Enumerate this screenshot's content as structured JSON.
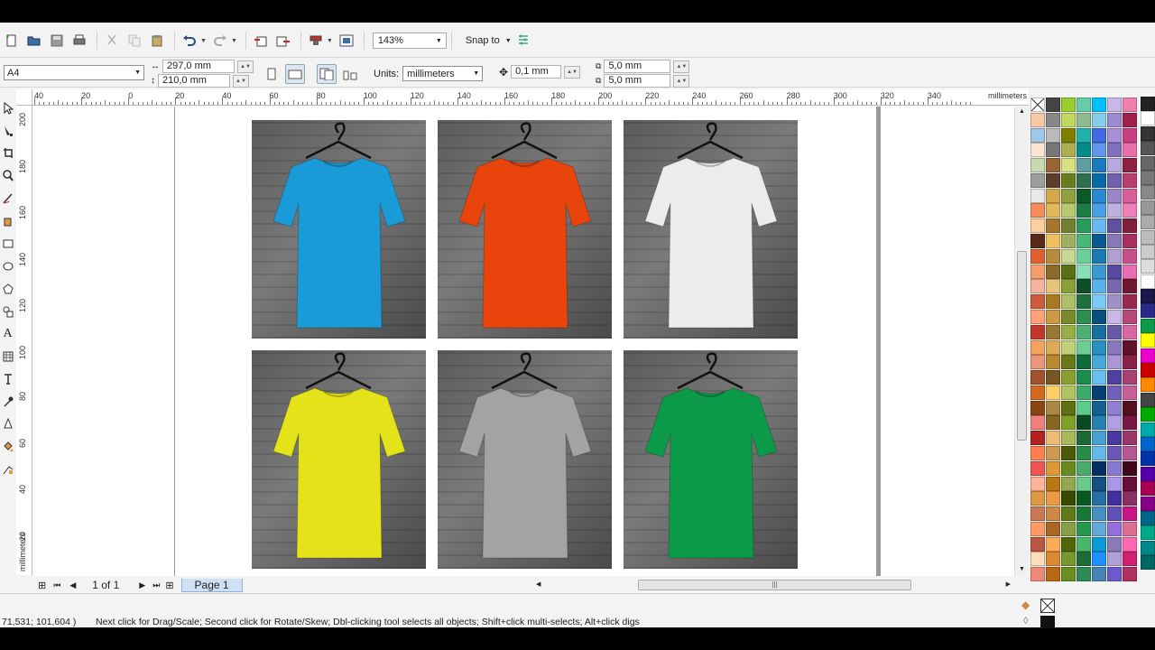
{
  "toolbar": {
    "zoom": "143%",
    "snap_label": "Snap to"
  },
  "property_bar": {
    "page_size": "A4",
    "width": "297,0 mm",
    "height": "210,0 mm",
    "units_label": "Units:",
    "units_value": "millimeters",
    "nudge": "0,1 mm",
    "dup_x": "5,0 mm",
    "dup_y": "5,0 mm"
  },
  "rulers": {
    "h_unit": "millimeters",
    "v_unit": "millimeters",
    "h_ticks": [
      "40",
      "20",
      "0",
      "20",
      "40",
      "60",
      "80",
      "100",
      "120",
      "140",
      "160",
      "180",
      "200",
      "220",
      "240",
      "260",
      "280",
      "300",
      "320",
      "340"
    ],
    "v_ticks": [
      "200",
      "180",
      "160",
      "140",
      "120",
      "100",
      "80",
      "60",
      "40",
      "20"
    ]
  },
  "canvas": {
    "shirts": [
      {
        "name": "blue-shirt",
        "color": "#1a9ad6"
      },
      {
        "name": "orange-shirt",
        "color": "#e8440c"
      },
      {
        "name": "white-shirt",
        "color": "#ececec"
      },
      {
        "name": "yellow-shirt",
        "color": "#e4e31a"
      },
      {
        "name": "gray-shirt",
        "color": "#a3a3a3"
      },
      {
        "name": "green-shirt",
        "color": "#0b9a48"
      }
    ]
  },
  "navigator": {
    "page_count": "1 of 1",
    "page_tab": "Page 1"
  },
  "status": {
    "coords": "71,531; 101,604 )",
    "hint": "Next click for Drag/Scale; Second click for Rotate/Skew; Dbl-clicking tool selects all objects; Shift+click multi-selects; Alt+click digs"
  }
}
